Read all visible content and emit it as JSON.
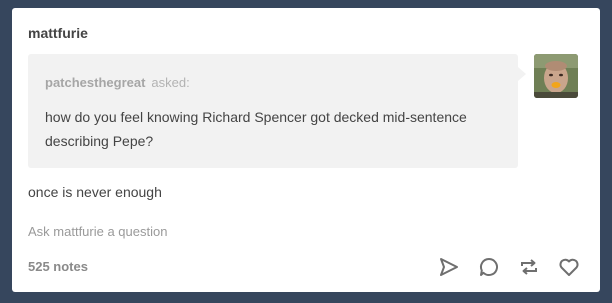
{
  "post": {
    "blog_name": "mattfurie",
    "ask": {
      "asker": "patchesthegreat",
      "asked_label": "asked:",
      "question": "how do you feel knowing Richard Spencer got decked mid-sentence describing Pepe?"
    },
    "answer": "once is never enough",
    "ask_link": "Ask mattfurie a question",
    "notes": "525 notes"
  },
  "icons": {
    "share": "share-icon",
    "reply": "reply-icon",
    "reblog": "reblog-icon",
    "like": "heart-icon"
  },
  "colors": {
    "background": "#36465d",
    "card": "#ffffff",
    "ask_box": "#f2f2f2",
    "text": "#444444",
    "muted": "#a6a6a6"
  }
}
